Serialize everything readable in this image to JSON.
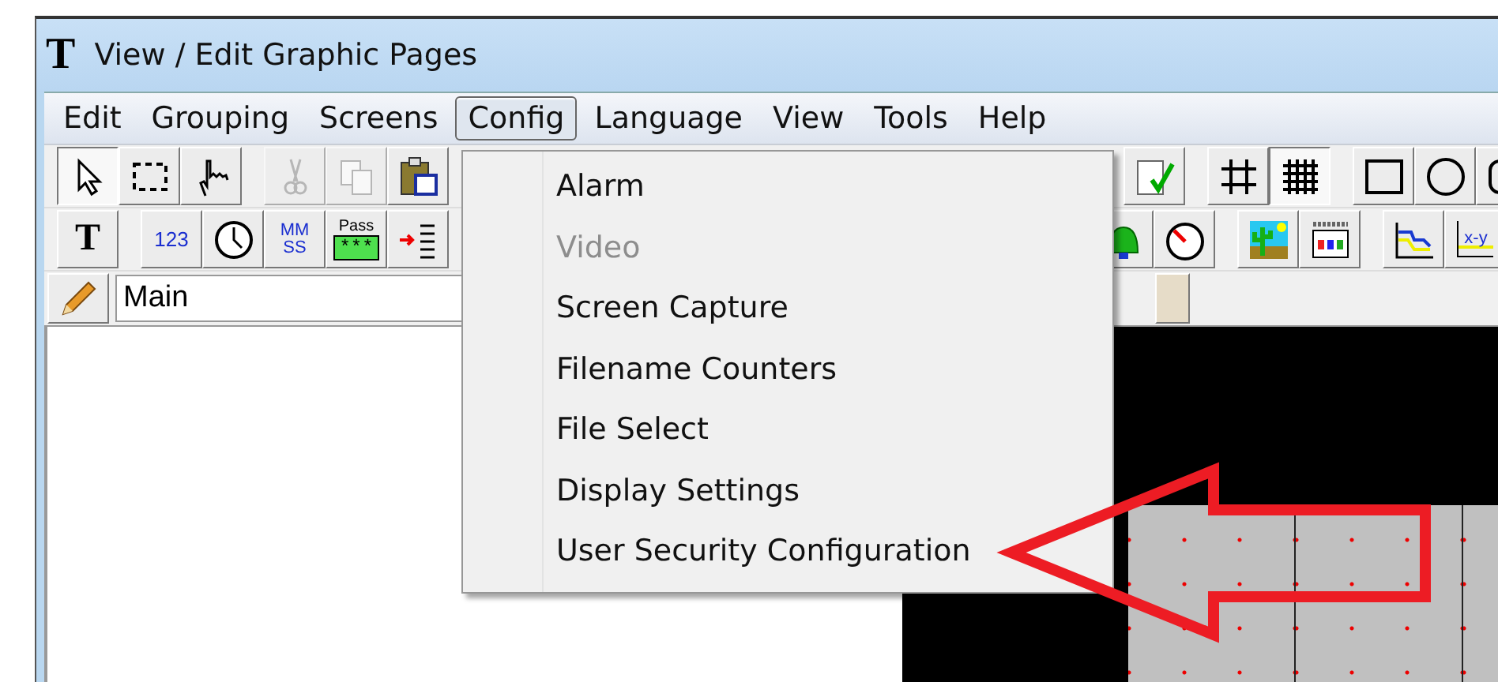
{
  "window": {
    "app_icon": "T",
    "title": "View / Edit Graphic Pages"
  },
  "menu_bar": [
    {
      "label": "Edit",
      "selected": false
    },
    {
      "label": "Grouping",
      "selected": false
    },
    {
      "label": "Screens",
      "selected": false
    },
    {
      "label": "Config",
      "selected": true
    },
    {
      "label": "Language",
      "selected": false
    },
    {
      "label": "View",
      "selected": false
    },
    {
      "label": "Tools",
      "selected": false
    },
    {
      "label": "Help",
      "selected": false
    }
  ],
  "toolbar_rows": [
    {
      "left": [
        {
          "kind": "pointer",
          "selected": true
        },
        {
          "kind": "marquee",
          "selected": false
        },
        {
          "kind": "hand",
          "selected": false
        },
        {
          "kind": "gap"
        },
        {
          "kind": "scissors",
          "disabled": true
        },
        {
          "kind": "copy",
          "disabled": true
        },
        {
          "kind": "clipboard",
          "disabled": false
        }
      ],
      "right": [
        {
          "kind": "doc-check",
          "selected": false
        },
        {
          "kind": "gap"
        },
        {
          "kind": "grid",
          "selected": false
        },
        {
          "kind": "grid-dense",
          "selected": true
        },
        {
          "kind": "gap"
        },
        {
          "kind": "rect",
          "selected": false
        },
        {
          "kind": "circle",
          "selected": false
        },
        {
          "kind": "rounded",
          "selected": false
        }
      ]
    },
    {
      "left": [
        {
          "kind": "text",
          "label": "T"
        },
        {
          "kind": "gap"
        },
        {
          "kind": "number",
          "label": "123"
        },
        {
          "kind": "clock"
        },
        {
          "kind": "time",
          "label": "MM",
          "label2": "SS"
        },
        {
          "kind": "password",
          "label": "Pass",
          "label2": "***"
        },
        {
          "kind": "arrow-list"
        }
      ],
      "right": [
        {
          "kind": "bell"
        },
        {
          "kind": "gauge"
        },
        {
          "kind": "gap"
        },
        {
          "kind": "cactus"
        },
        {
          "kind": "table"
        },
        {
          "kind": "gap"
        },
        {
          "kind": "trend"
        },
        {
          "kind": "xy",
          "label": "x-y"
        }
      ]
    }
  ],
  "page_field": {
    "value": "Main"
  },
  "config_menu": [
    {
      "label": "Alarm",
      "disabled": false
    },
    {
      "label": "Video",
      "disabled": true
    },
    {
      "label": "Screen Capture",
      "disabled": false
    },
    {
      "label": "Filename Counters",
      "disabled": false
    },
    {
      "label": "File Select",
      "disabled": false
    },
    {
      "label": "Display Settings",
      "disabled": false
    },
    {
      "label": "User  Security Configuration",
      "disabled": false
    }
  ]
}
